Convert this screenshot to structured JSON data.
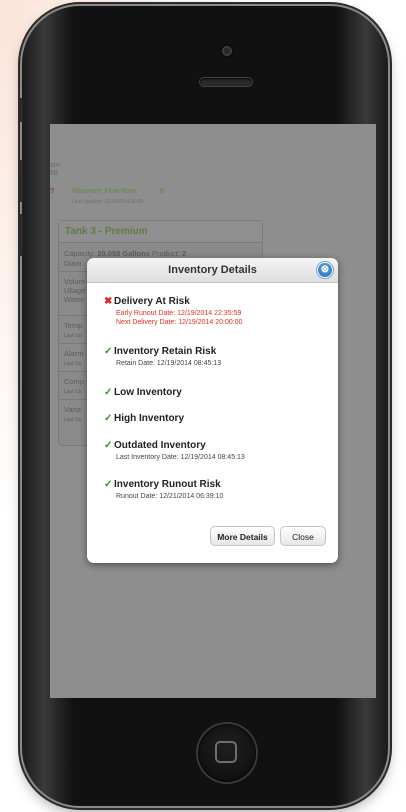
{
  "background_app": {
    "left_labels": [
      "ate:",
      "08"
    ],
    "flow_rate": {
      "label": "Maximum Flow Rate:",
      "value": "0"
    },
    "last_updated": "Last Updated: 12/19/2014 00:00",
    "tank": {
      "title": "Tank 3 - Premium",
      "capacity_label": "Capacity:",
      "capacity_value": "20,058 Gallons",
      "product_label": "Product:",
      "product_value": "2",
      "rows": [
        "Diam",
        "Volum",
        "Ullage",
        "Water",
        "Temp",
        "Last Up",
        "Alarm",
        "Last Up",
        "Comp",
        "Last Up",
        "Varia",
        "Last Up"
      ]
    }
  },
  "modal": {
    "title": "Inventory Details",
    "items": [
      {
        "status": "bad",
        "mark": "✖",
        "title": "Delivery At Risk",
        "lines": [
          "Early Runout Date: 12/19/2014 22:35:59",
          "Next Delivery Date: 12/19/2014 20:00:00"
        ]
      },
      {
        "status": "ok",
        "mark": "✓",
        "title": "Inventory Retain Risk",
        "lines": [
          "Retain Date: 12/19/2014 08:45:13"
        ]
      },
      {
        "status": "ok",
        "mark": "✓",
        "title": "Low Inventory",
        "lines": []
      },
      {
        "status": "ok",
        "mark": "✓",
        "title": "High Inventory",
        "lines": []
      },
      {
        "status": "ok",
        "mark": "✓",
        "title": "Outdated Inventory",
        "lines": [
          "Last Inventory Date: 12/19/2014 08:45:13"
        ]
      },
      {
        "status": "ok",
        "mark": "✓",
        "title": "Inventory Runout Risk",
        "lines": [
          "Runout Date: 12/21/2014 06:39:10"
        ]
      }
    ],
    "more_details_label": "More Details",
    "close_label": "Close",
    "close_icon": "⊗"
  },
  "colors": {
    "ok": "#3c8c2e",
    "bad": "#d6281e",
    "modal_title": "#333333",
    "tank_title": "#5a7f44"
  }
}
